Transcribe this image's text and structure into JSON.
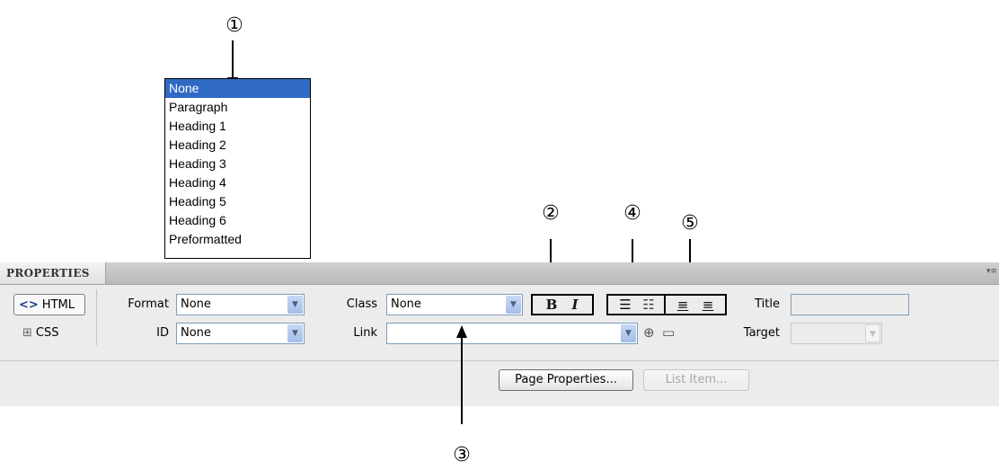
{
  "callouts": {
    "c1": "①",
    "c2": "②",
    "c3": "③",
    "c4": "④",
    "c5": "⑤"
  },
  "format_dropdown": {
    "options": [
      "None",
      "Paragraph",
      "Heading 1",
      "Heading 2",
      "Heading 3",
      "Heading 4",
      "Heading 5",
      "Heading 6",
      "Preformatted"
    ],
    "selected": "None"
  },
  "panel": {
    "title": "PROPERTIES",
    "menu_icon": "panel-options-icon"
  },
  "mode_buttons": {
    "html_label": "HTML",
    "css_label": "CSS",
    "html_icon": "code-brackets-icon",
    "css_icon": "css-rules-icon"
  },
  "fields": {
    "format_label": "Format",
    "format_value": "None",
    "id_label": "ID",
    "id_value": "None",
    "class_label": "Class",
    "class_value": "None",
    "link_label": "Link",
    "link_value": "",
    "title_label": "Title",
    "title_value": "",
    "target_label": "Target",
    "target_value": ""
  },
  "formatting": {
    "bold_label": "B",
    "italic_label": "I"
  },
  "icons": {
    "unordered_list": "unordered-list-icon",
    "ordered_list": "ordered-list-icon",
    "outdent": "outdent-icon",
    "indent": "indent-icon",
    "point_to_file": "point-to-file-icon",
    "browse_folder": "folder-icon"
  },
  "buttons": {
    "page_properties": "Page Properties...",
    "list_item": "List Item..."
  },
  "colors": {
    "selection": "#316ac5",
    "panel_bg": "#ececec",
    "header_bg": "#c4c4c4"
  }
}
